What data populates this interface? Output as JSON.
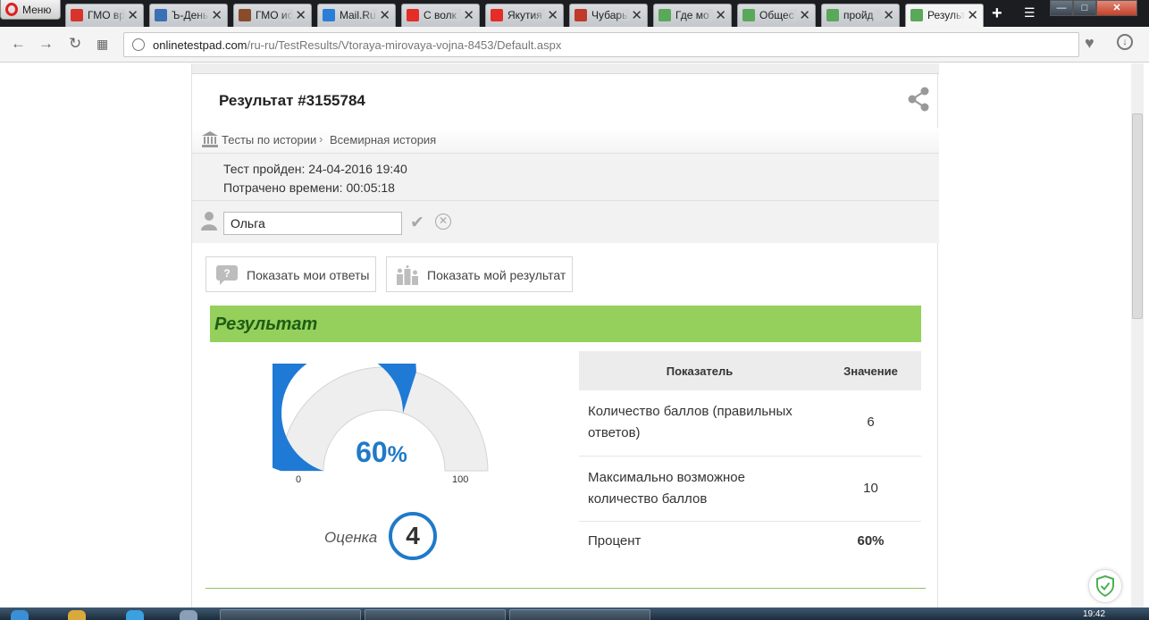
{
  "browser": {
    "menu_label": "Меню",
    "tabs": [
      {
        "label": "ГМО вре",
        "icon_color": "#d9342b"
      },
      {
        "label": "Ъ-Деньги",
        "icon_color": "#3b6fb6"
      },
      {
        "label": "ГМО ис",
        "icon_color": "#8a4b2a"
      },
      {
        "label": "Mail.Ru",
        "icon_color": "#2b7ed8"
      },
      {
        "label": "С волк",
        "icon_color": "#e52d27"
      },
      {
        "label": "Якутия",
        "icon_color": "#e52d27"
      },
      {
        "label": "Чубарь",
        "icon_color": "#c0392b"
      },
      {
        "label": "Где мо",
        "icon_color": "#5aa85a"
      },
      {
        "label": "Общес",
        "icon_color": "#5aa85a"
      },
      {
        "label": "пройд",
        "icon_color": "#5aa85a"
      },
      {
        "label": "Результ",
        "icon_color": "#5aa85a"
      }
    ],
    "url_host": "onlinetestpad.com",
    "url_path": "/ru-ru/TestResults/Vtoraya-mirovaya-vojna-8453/Default.aspx"
  },
  "page": {
    "title": "Результат #3155784",
    "breadcrumb": [
      "Тесты по истории",
      "Всемирная история"
    ],
    "test_passed": "Тест пройден: 24-04-2016 19:40",
    "time_spent": "Потрачено времени: 00:05:18",
    "user_name": "Ольга",
    "show_answers_label": "Показать мои ответы",
    "show_result_label": "Показать мой результат",
    "result_header": "Результат"
  },
  "gauge": {
    "percent": 60,
    "value_text": "60",
    "percent_sign": "%",
    "min_label": "0",
    "max_label": "100",
    "fill_color": "#1f7ad6",
    "track_color": "#eeeeee"
  },
  "grade": {
    "label": "Оценка",
    "value": "4"
  },
  "stats_table": {
    "headers": [
      "Показатель",
      "Значение"
    ],
    "rows": [
      {
        "label": "Количество баллов (правильных ответов)",
        "value": "6"
      },
      {
        "label": "Максимально возможное количество баллов",
        "value": "10"
      },
      {
        "label": "Процент",
        "value": "60%"
      }
    ]
  },
  "taskbar": {
    "clock": "19:42"
  }
}
